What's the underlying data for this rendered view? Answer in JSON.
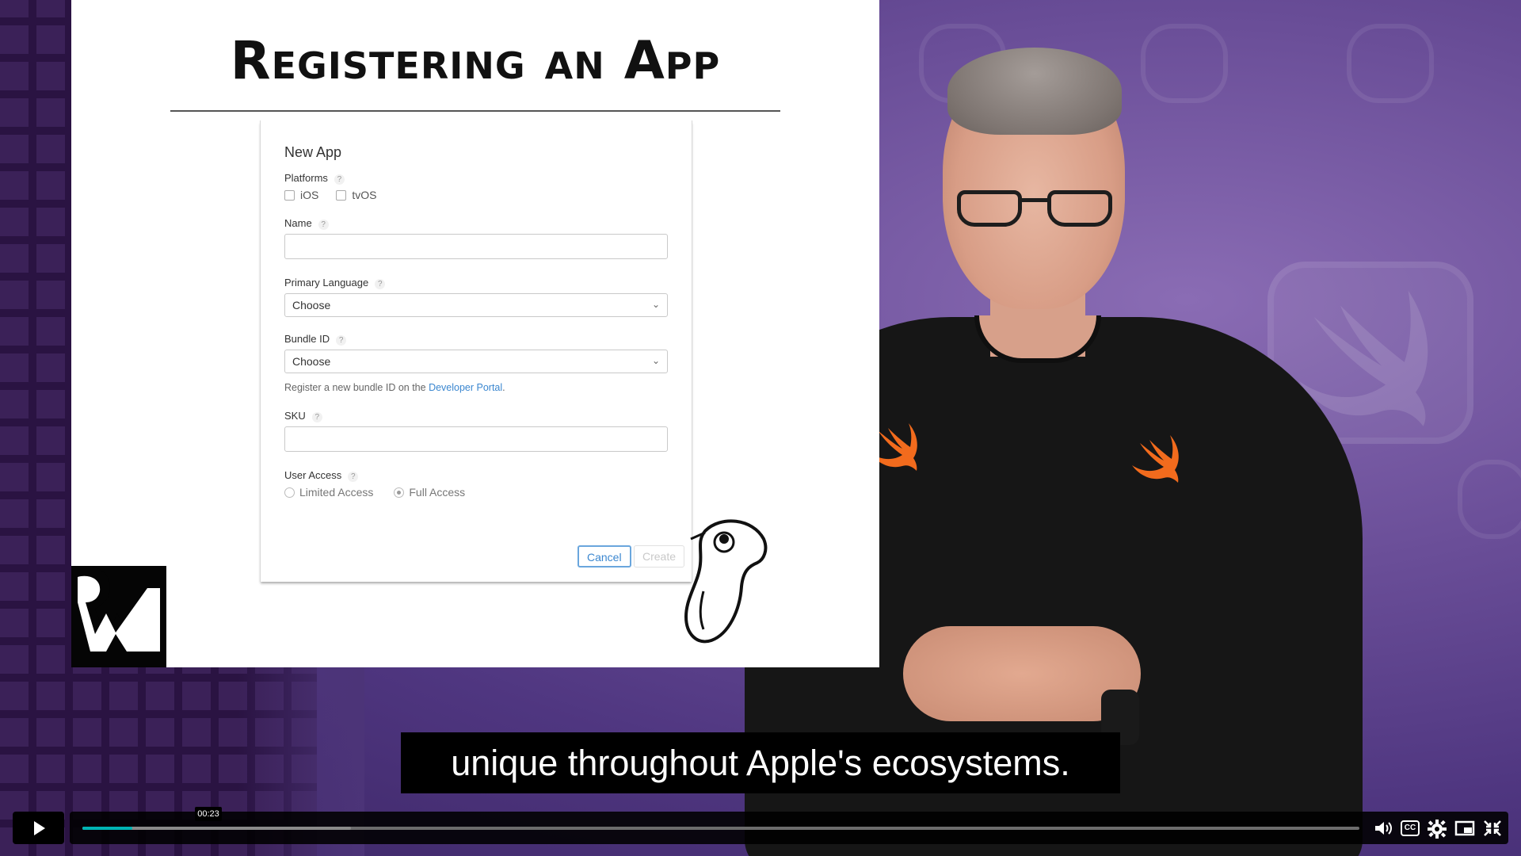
{
  "slide": {
    "title": "Registering an App"
  },
  "dialog": {
    "title": "New App",
    "platforms_label": "Platforms",
    "platform_options": [
      "iOS",
      "tvOS"
    ],
    "name_label": "Name",
    "primary_language_label": "Primary Language",
    "primary_language_value": "Choose",
    "bundle_id_label": "Bundle ID",
    "bundle_id_value": "Choose",
    "bundle_hint_prefix": "Register a new bundle ID on the ",
    "bundle_hint_link": "Developer Portal",
    "bundle_hint_suffix": ".",
    "sku_label": "SKU",
    "user_access_label": "User Access",
    "user_access_options": [
      "Limited Access",
      "Full Access"
    ],
    "user_access_selected": "Full Access",
    "help_glyph": "?",
    "cancel_label": "Cancel",
    "create_label": "Create"
  },
  "caption": {
    "text": "unique throughout Apple's ecosystems."
  },
  "player": {
    "current_time": "00:23",
    "progress_fraction": 0.039,
    "buffered_fraction": 0.21,
    "icons": [
      "play-icon",
      "volume-icon",
      "closed-captions-icon",
      "settings-gear-icon",
      "picture-in-picture-icon",
      "exit-fullscreen-icon"
    ],
    "cc_label": "CC",
    "accent_color": "#00b4b4"
  }
}
